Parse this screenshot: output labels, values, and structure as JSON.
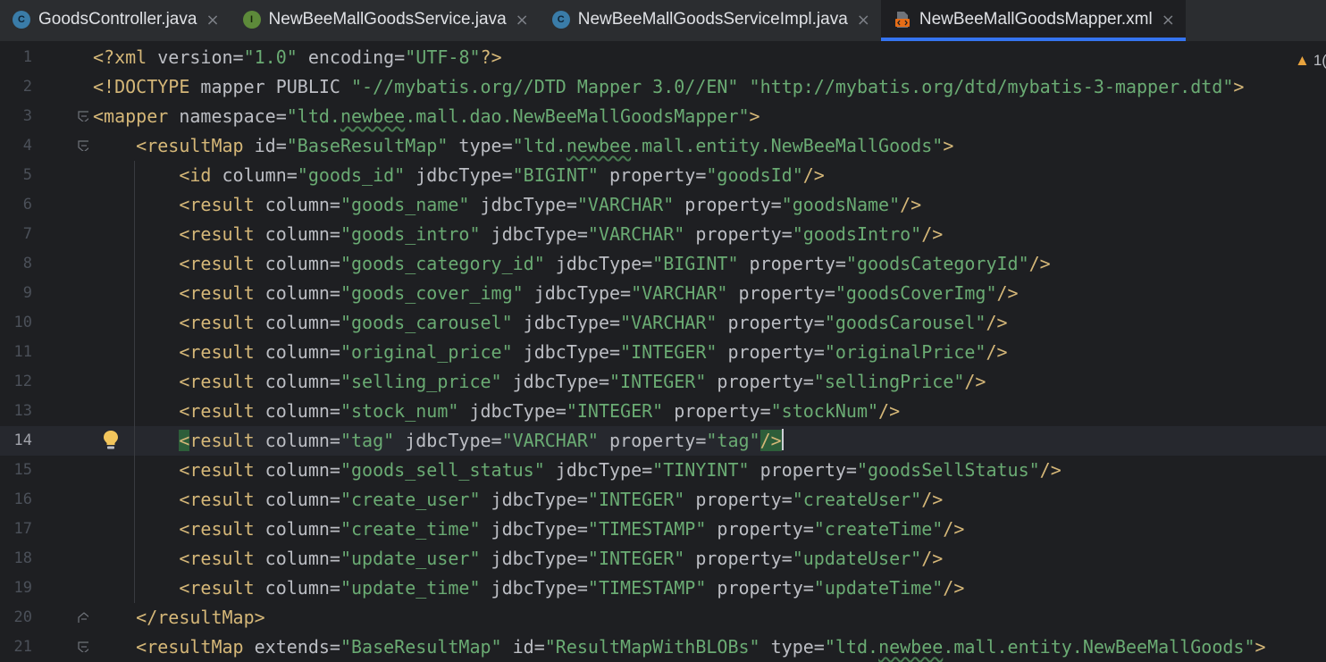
{
  "tabs": [
    {
      "label": "GoodsController.java",
      "icon": "class-icon",
      "badge": "C",
      "active": false
    },
    {
      "label": "NewBeeMallGoodsService.java",
      "icon": "interface-icon",
      "badge": "I",
      "active": false
    },
    {
      "label": "NewBeeMallGoodsServiceImpl.java",
      "icon": "class-icon",
      "badge": "C",
      "active": false
    },
    {
      "label": "NewBeeMallGoodsMapper.xml",
      "icon": "xml-file-icon",
      "badge": "",
      "active": true
    }
  ],
  "close_glyph": "×",
  "inspection": {
    "icon": "warning-icon",
    "glyph": "▲",
    "count": "1("
  },
  "editor": {
    "current_line": 14,
    "lines": [
      {
        "n": "1",
        "text": "<?xml version=\"1.0\" encoding=\"UTF-8\"?>"
      },
      {
        "n": "2",
        "text": "<!DOCTYPE mapper PUBLIC \"-//mybatis.org//DTD Mapper 3.0//EN\" \"http://mybatis.org/dtd/mybatis-3-mapper.dtd\">"
      },
      {
        "n": "3",
        "text": "<mapper namespace=\"ltd.newbee.mall.dao.NewBeeMallGoodsMapper\">"
      },
      {
        "n": "4",
        "text": "    <resultMap id=\"BaseResultMap\" type=\"ltd.newbee.mall.entity.NewBeeMallGoods\">"
      },
      {
        "n": "5",
        "text": "        <id column=\"goods_id\" jdbcType=\"BIGINT\" property=\"goodsId\"/>"
      },
      {
        "n": "6",
        "text": "        <result column=\"goods_name\" jdbcType=\"VARCHAR\" property=\"goodsName\"/>"
      },
      {
        "n": "7",
        "text": "        <result column=\"goods_intro\" jdbcType=\"VARCHAR\" property=\"goodsIntro\"/>"
      },
      {
        "n": "8",
        "text": "        <result column=\"goods_category_id\" jdbcType=\"BIGINT\" property=\"goodsCategoryId\"/>"
      },
      {
        "n": "9",
        "text": "        <result column=\"goods_cover_img\" jdbcType=\"VARCHAR\" property=\"goodsCoverImg\"/>"
      },
      {
        "n": "10",
        "text": "        <result column=\"goods_carousel\" jdbcType=\"VARCHAR\" property=\"goodsCarousel\"/>"
      },
      {
        "n": "11",
        "text": "        <result column=\"original_price\" jdbcType=\"INTEGER\" property=\"originalPrice\"/>"
      },
      {
        "n": "12",
        "text": "        <result column=\"selling_price\" jdbcType=\"INTEGER\" property=\"sellingPrice\"/>"
      },
      {
        "n": "13",
        "text": "        <result column=\"stock_num\" jdbcType=\"INTEGER\" property=\"stockNum\"/>"
      },
      {
        "n": "14",
        "text": "        <result column=\"tag\" jdbcType=\"VARCHAR\" property=\"tag\"/>"
      },
      {
        "n": "15",
        "text": "        <result column=\"goods_sell_status\" jdbcType=\"TINYINT\" property=\"goodsSellStatus\"/>"
      },
      {
        "n": "16",
        "text": "        <result column=\"create_user\" jdbcType=\"INTEGER\" property=\"createUser\"/>"
      },
      {
        "n": "17",
        "text": "        <result column=\"create_time\" jdbcType=\"TIMESTAMP\" property=\"createTime\"/>"
      },
      {
        "n": "18",
        "text": "        <result column=\"update_user\" jdbcType=\"INTEGER\" property=\"updateUser\"/>"
      },
      {
        "n": "19",
        "text": "        <result column=\"update_time\" jdbcType=\"TIMESTAMP\" property=\"updateTime\"/>"
      },
      {
        "n": "20",
        "text": "    </resultMap>"
      },
      {
        "n": "21",
        "text": "    <resultMap extends=\"BaseResultMap\" id=\"ResultMapWithBLOBs\" type=\"ltd.newbee.mall.entity.NewBeeMallGoods\">"
      }
    ]
  },
  "colors": {
    "tag": "#d5b778",
    "attribute": "#bcbec4",
    "string": "#6aab73",
    "accent": "#3574f0",
    "background": "#1e1f22"
  }
}
